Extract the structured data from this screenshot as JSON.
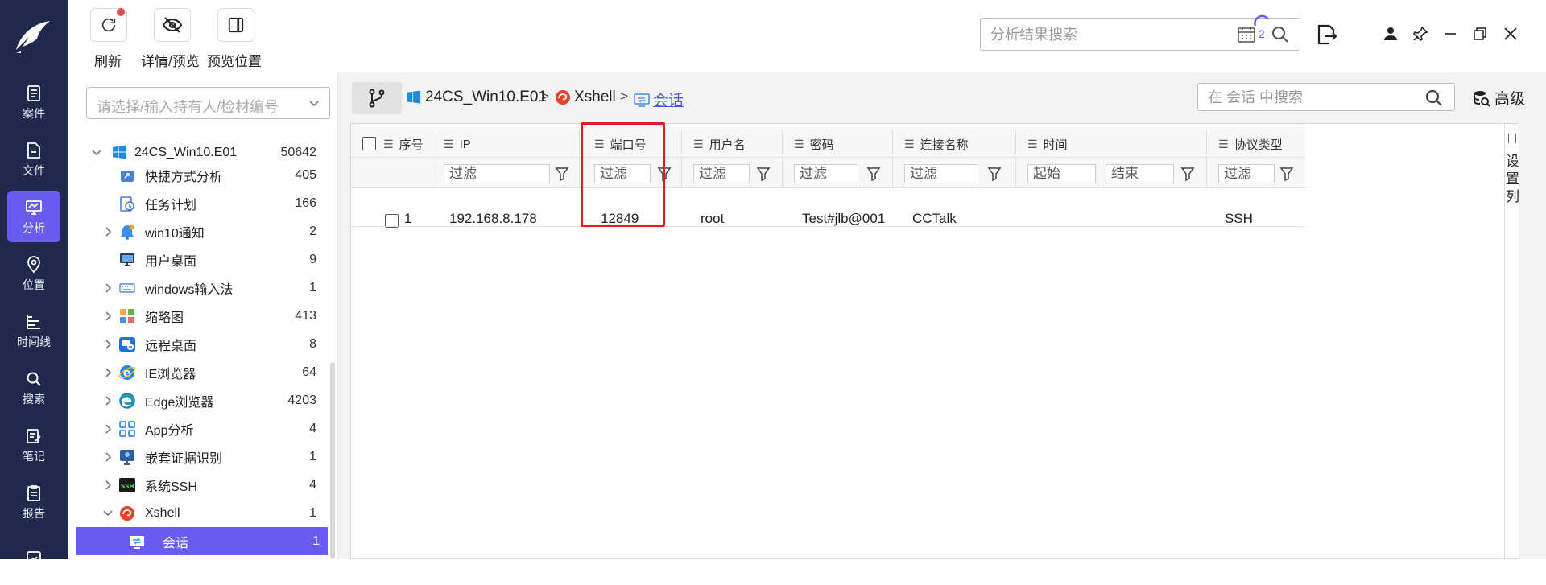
{
  "nav": {
    "items": [
      {
        "label": "案件",
        "icon": "case-icon"
      },
      {
        "label": "文件",
        "icon": "file-icon"
      },
      {
        "label": "分析",
        "icon": "analysis-icon",
        "active": true
      },
      {
        "label": "位置",
        "icon": "location-icon"
      },
      {
        "label": "时间线",
        "icon": "timeline-icon"
      },
      {
        "label": "搜索",
        "icon": "search-icon"
      },
      {
        "label": "笔记",
        "icon": "note-icon"
      },
      {
        "label": "报告",
        "icon": "report-icon"
      }
    ]
  },
  "toolbar": {
    "refresh_label": "刷新",
    "detail_preview_label": "详情/预览",
    "preview_position_label": "预览位置",
    "search_placeholder": "分析结果搜索",
    "task_count": "2"
  },
  "tree": {
    "holder_placeholder": "请选择/输入持有人/检材编号",
    "root": {
      "label": "24CS_Win10.E01",
      "count": "50642"
    },
    "items": [
      {
        "label": "快捷方式分析",
        "count": "405",
        "expandable": false
      },
      {
        "label": "任务计划",
        "count": "166",
        "expandable": false
      },
      {
        "label": "win10通知",
        "count": "2",
        "expandable": true
      },
      {
        "label": "用户桌面",
        "count": "9",
        "expandable": false
      },
      {
        "label": "windows输入法",
        "count": "1",
        "expandable": true
      },
      {
        "label": "缩略图",
        "count": "413",
        "expandable": true
      },
      {
        "label": "远程桌面",
        "count": "8",
        "expandable": true
      },
      {
        "label": "IE浏览器",
        "count": "64",
        "expandable": true
      },
      {
        "label": "Edge浏览器",
        "count": "4203",
        "expandable": true
      },
      {
        "label": "App分析",
        "count": "4",
        "expandable": true
      },
      {
        "label": "嵌套证据识别",
        "count": "1",
        "expandable": true
      },
      {
        "label": "系统SSH",
        "count": "4",
        "expandable": true
      },
      {
        "label": "Xshell",
        "count": "1",
        "expandable": true,
        "expanded": true
      },
      {
        "label": "会话",
        "count": "1",
        "selected": true
      }
    ]
  },
  "breadcrumb": {
    "image": "24CS_Win10.E01",
    "app": "Xshell",
    "current": "会话",
    "sep": ">"
  },
  "main": {
    "search_placeholder": "在 会话 中搜索",
    "advanced_label": "高级"
  },
  "grid": {
    "columns": [
      "序号",
      "IP",
      "端口号",
      "用户名",
      "密码",
      "连接名称",
      "时间",
      "协议类型"
    ],
    "filter_placeholder": "过滤",
    "time_start": "起始",
    "time_end": "结束",
    "rows": [
      {
        "index": "1",
        "ip": "192.168.8.178",
        "port": "12849",
        "user": "root",
        "password": "Test#jlb@001",
        "name": "CCTalk",
        "time": "",
        "protocol": "SSH"
      }
    ],
    "settings_label": "设置列"
  },
  "colors": {
    "nav_bg": "#1f2a4d",
    "accent": "#6b5cf0",
    "highlight": "#e02020"
  }
}
